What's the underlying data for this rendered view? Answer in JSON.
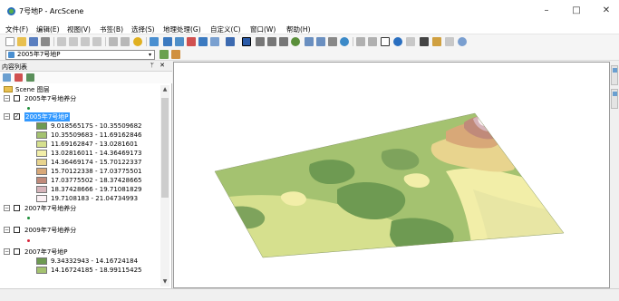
{
  "window": {
    "title": "7号地P - ArcScene",
    "minimize_glyph": "–",
    "maximize_glyph": "□",
    "close_glyph": "✕"
  },
  "menu": {
    "items": [
      "文件(F)",
      "编辑(E)",
      "视图(V)",
      "书签(B)",
      "选择(S)",
      "地理处理(G)",
      "自定义(C)",
      "窗口(W)",
      "帮助(H)"
    ]
  },
  "toolbar": {
    "layer_select_value": "2005年7号地P",
    "layer_select_arrow": "▾"
  },
  "toc": {
    "title": "内容列表",
    "pin_glyph": "ᛘ",
    "close_glyph": "✕",
    "scroll_up": "▲",
    "scroll_down": "▼",
    "scene_label": "Scene 图层",
    "layers": [
      {
        "name": "2005年7号地养分",
        "checked": false,
        "expanded": true,
        "symbol": "dot",
        "color": "#1e8f3a"
      },
      {
        "name": "2005年7号地P",
        "checked": true,
        "expanded": true,
        "selected": true,
        "classes": [
          {
            "label": "9.01856517S - 10.35509682",
            "color": "#6e9a52"
          },
          {
            "label": "10.35509683 - 11.69162846",
            "color": "#a4c270"
          },
          {
            "label": "11.69162847 - 13.0281601",
            "color": "#d6e08e"
          },
          {
            "label": "13.02816011 - 14.36469173",
            "color": "#f2eea8"
          },
          {
            "label": "14.36469174 - 15.70122337",
            "color": "#e8d48e"
          },
          {
            "label": "15.70122338 - 17.03775501",
            "color": "#d8a878"
          },
          {
            "label": "17.03775502 - 18.37428665",
            "color": "#c08a7a"
          },
          {
            "label": "18.37428666 - 19.71081829",
            "color": "#d6b4ba"
          },
          {
            "label": "19.7108183 - 21.04734993",
            "color": "#fbf1f4"
          }
        ]
      },
      {
        "name": "2007年7号地养分",
        "checked": false,
        "expanded": true,
        "symbol": "dot",
        "color": "#1e8f3a"
      },
      {
        "name": "2009年7号地养分",
        "checked": false,
        "expanded": true,
        "symbol": "dot",
        "color": "#d8243a"
      },
      {
        "name": "2007年7号地P",
        "checked": false,
        "expanded": true,
        "classes": [
          {
            "label": "9.34332943 - 14.16724184",
            "color": "#6e9a52"
          },
          {
            "label": "14.16724185 - 18.99115425",
            "color": "#a4c270"
          }
        ]
      }
    ]
  },
  "colors": {
    "selection": "#3399ff",
    "terrain_low": "#6e9a52",
    "terrain_mid": "#d6e08e",
    "terrain_high": "#c08a7a",
    "terrain_peak": "#fbf1f4"
  }
}
